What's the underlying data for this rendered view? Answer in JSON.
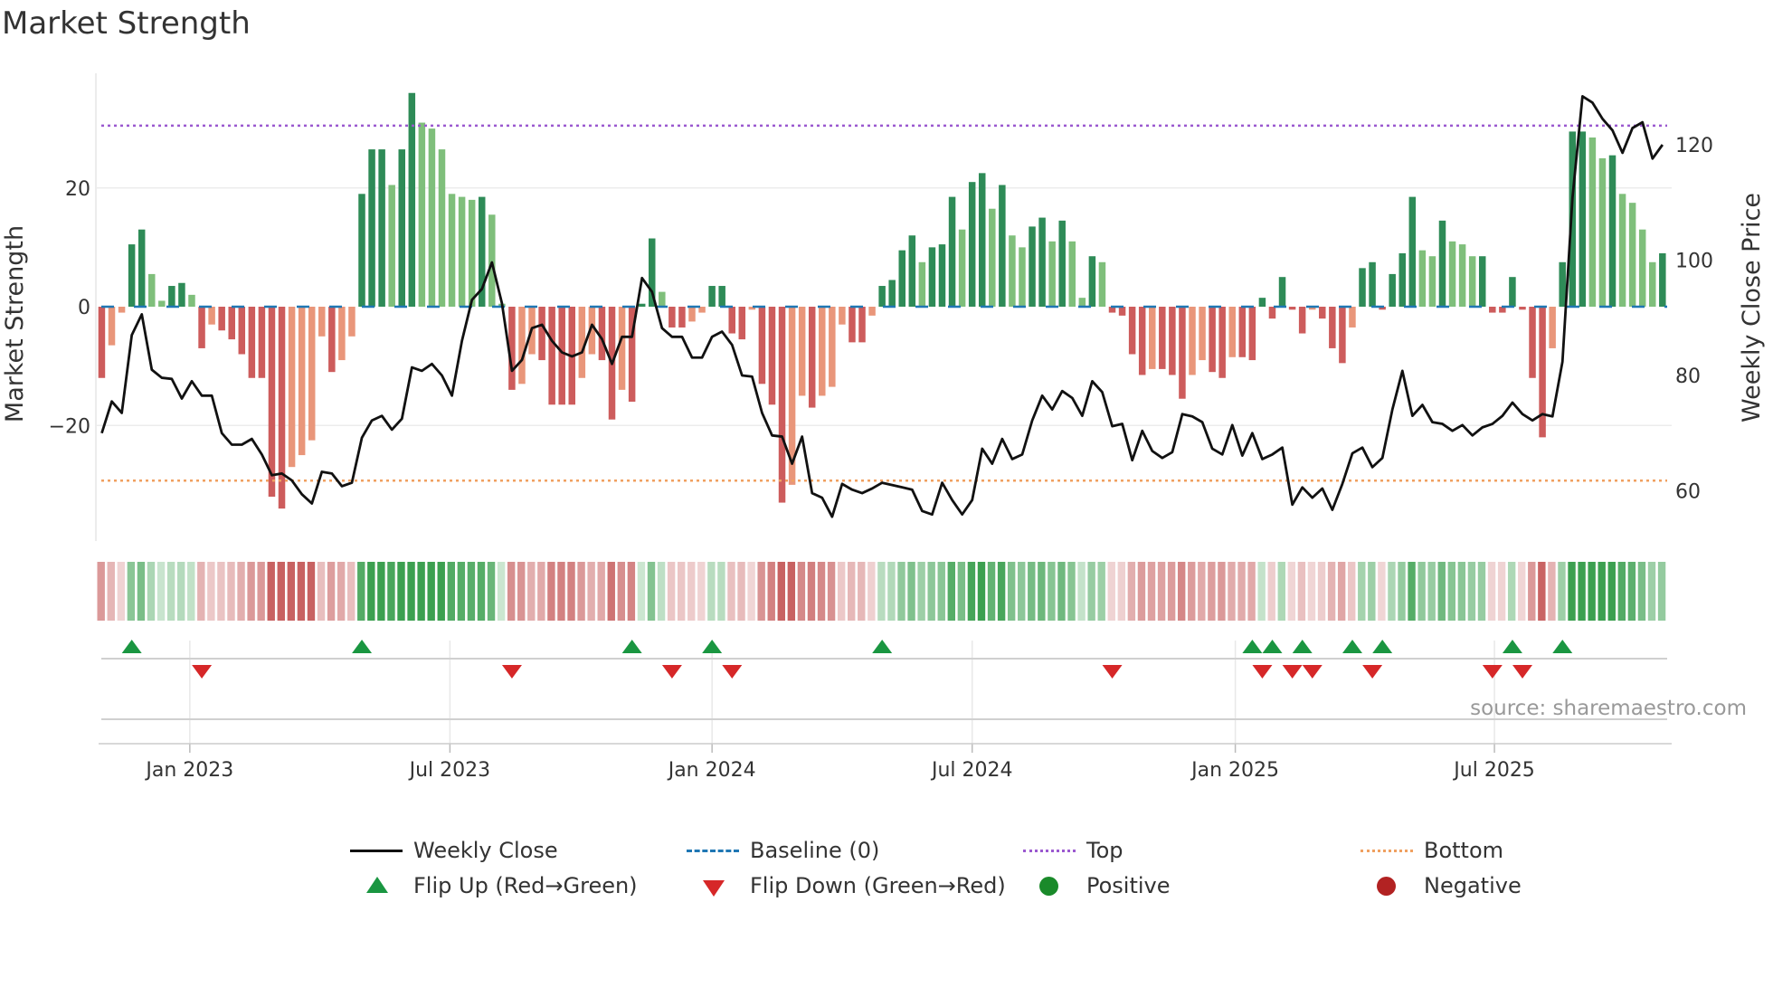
{
  "title": "Market Strength",
  "source": "source: sharemaestro.com",
  "legend": {
    "weekly_close": "Weekly Close",
    "baseline": "Baseline (0)",
    "top": "Top",
    "bottom": "Bottom",
    "flip_up": "Flip Up (Red→Green)",
    "flip_down": "Flip Down (Green→Red)",
    "positive": "Positive",
    "negative": "Negative"
  },
  "chart_data": {
    "type": "bar",
    "title": "Market Strength",
    "ylabel": "Market Strength",
    "y2label": "Weekly Close Price",
    "ylim": [
      -40,
      38
    ],
    "y2lim": [
      52,
      135
    ],
    "yticks": [
      -20,
      0,
      20
    ],
    "y2ticks": [
      60,
      80,
      100,
      120
    ],
    "xticks": [
      {
        "label": "Jan 2023",
        "week": 8.8
      },
      {
        "label": "Jul 2023",
        "week": 34.8
      },
      {
        "label": "Jan 2024",
        "week": 61.0
      },
      {
        "label": "Jul 2024",
        "week": 87.0
      },
      {
        "label": "Jan 2025",
        "week": 113.3
      },
      {
        "label": "Jul 2025",
        "week": 139.2
      }
    ],
    "first_week": "2022-11-04",
    "top_level": 30.5,
    "bottom_level": -29.3,
    "colors": {
      "dark_green": "#2e8b57",
      "light_green": "#7fbf7b",
      "dark_red": "#cd5c5c",
      "light_red": "#e9967a",
      "top": "#9b59d0",
      "bottom": "#f0a060",
      "baseline": "#1f77b4",
      "flip_up": "#1a9641",
      "flip_down": "#d62728",
      "positive": "#1a8a2a",
      "negative": "#b22222"
    },
    "strength": [
      -12,
      -6.5,
      -1,
      10.5,
      13,
      5.5,
      1,
      3.5,
      4,
      2,
      -7,
      -3,
      -4,
      -5.5,
      -8,
      -12,
      -12,
      -32,
      -34,
      -27,
      -25,
      -22.5,
      -5,
      -11,
      -9,
      -5,
      19,
      26.5,
      26.5,
      20.5,
      26.5,
      36,
      31,
      30,
      26.5,
      19,
      18.5,
      18,
      18.5,
      15.5,
      0.5,
      -14,
      -13,
      -8,
      -9,
      -16.5,
      -16.5,
      -16.5,
      -12,
      -8,
      -9,
      -19,
      -14,
      -16,
      0.5,
      11.5,
      2.5,
      -3.5,
      -3.5,
      -2.5,
      -1,
      3.5,
      3.5,
      -4.5,
      -5.5,
      -0.5,
      -13,
      -16.5,
      -33,
      -30,
      -15,
      -17,
      -15,
      -13.5,
      -3,
      -6,
      -6,
      -1.5,
      3.5,
      4.5,
      9.5,
      12,
      7.5,
      10,
      10.5,
      18.5,
      13,
      21,
      22.5,
      16.5,
      20.5,
      12,
      10,
      13.5,
      15,
      11,
      14.5,
      11,
      1.5,
      8.5,
      7.5,
      -1,
      -1.5,
      -8,
      -11.5,
      -10.5,
      -10.5,
      -11.5,
      -15.5,
      -11.5,
      -9,
      -11,
      -12,
      -8.5,
      -8.5,
      -9,
      1.5,
      -2,
      5,
      -0.5,
      -4.5,
      -0.5,
      -2,
      -7,
      -9.5,
      -3.5,
      6.5,
      7.5,
      -0.5,
      5.5,
      9,
      18.5,
      9.5,
      8.5,
      14.5,
      11,
      10.5,
      8.5,
      8.5,
      -1,
      -1,
      5,
      -0.5,
      -12,
      -22,
      -7,
      7.5,
      29.5,
      29.5,
      28.5,
      25,
      25.5,
      19,
      17.5,
      13,
      7.5,
      9
    ],
    "weekly_close": [
      70,
      75.5,
      73.5,
      87,
      90.6,
      81,
      79.6,
      79.4,
      76,
      79,
      76.5,
      76.5,
      70,
      68,
      68,
      69,
      66.3,
      62.7,
      63,
      61.8,
      59.4,
      57.8,
      63.3,
      63,
      60.8,
      61.4,
      69.2,
      72.2,
      73,
      70.6,
      72.5,
      81.4,
      80.8,
      82,
      80,
      76.5,
      86,
      93.1,
      95,
      99.6,
      92.5,
      80.8,
      82.7,
      88.2,
      88.8,
      86,
      84,
      83.3,
      84,
      88.8,
      86.3,
      82,
      86.7,
      86.7,
      96.9,
      94.5,
      88.2,
      86.7,
      86.7,
      83.1,
      83.1,
      86.7,
      87.6,
      85.3,
      80,
      79.8,
      73.5,
      69.6,
      69.4,
      64.7,
      69.4,
      59.6,
      58.8,
      55.5,
      61.2,
      60.2,
      59.6,
      60.4,
      61.4,
      61,
      60.6,
      60.2,
      56.5,
      55.9,
      61.4,
      58.4,
      55.9,
      58.4,
      67.3,
      64.7,
      69,
      65.5,
      66.3,
      72.2,
      76.5,
      74.1,
      77.3,
      76.1,
      73,
      79,
      77.1,
      71.2,
      71.6,
      65.3,
      70.4,
      66.9,
      65.7,
      66.7,
      73.3,
      72.9,
      71.9,
      67.3,
      66.3,
      71.4,
      66.1,
      70,
      65.5,
      66.3,
      67.5,
      57.6,
      60.6,
      58.8,
      60.4,
      56.7,
      61.2,
      66.5,
      67.5,
      64.1,
      65.7,
      74.1,
      80.8,
      73,
      74.9,
      71.9,
      71.6,
      70.4,
      71.4,
      69.6,
      71,
      71.6,
      73,
      75.3,
      73.3,
      72.2,
      73.3,
      72.9,
      82.4,
      110.8,
      128.4,
      127.3,
      124.5,
      122.5,
      118.6,
      122.9,
      123.9,
      117.6,
      120
    ],
    "flip_up_weeks": [
      3,
      26,
      53,
      61,
      78,
      115,
      117,
      120,
      125,
      128,
      141,
      146
    ],
    "flip_down_weeks": [
      10,
      41,
      57,
      63,
      101,
      116,
      119,
      121,
      127,
      139,
      142
    ],
    "legend_position": "bottom"
  }
}
